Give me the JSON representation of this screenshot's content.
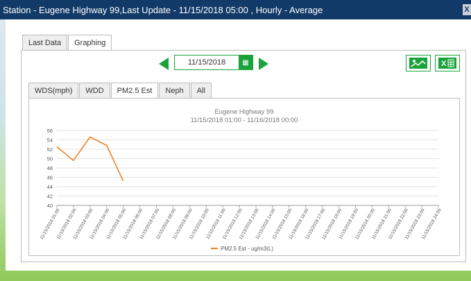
{
  "window": {
    "title": "Station - Eugene Highway 99,Last Update - 11/15/2018 05:00 , Hourly - Average",
    "close_label": "X"
  },
  "outer_tabs": [
    {
      "label": "Last Data",
      "active": false
    },
    {
      "label": "Graphing",
      "active": true
    }
  ],
  "date_picker": {
    "value": "11/15/2018",
    "calendar_icon": "calendar-icon"
  },
  "export": {
    "chart_icon": "chart-image-icon",
    "excel_icon": "excel-icon",
    "excel_label": "X"
  },
  "inner_tabs": [
    {
      "label": "WDS(mph)",
      "active": false
    },
    {
      "label": "WDD",
      "active": false
    },
    {
      "label": "PM2.5 Est",
      "active": true
    },
    {
      "label": "Neph",
      "active": false
    },
    {
      "label": "All",
      "active": false
    }
  ],
  "colors": {
    "accent": "#1aa33a",
    "series": "#f07f23",
    "title_bar": "#123a68"
  },
  "chart_data": {
    "type": "line",
    "title": "Eugene Highway 99",
    "subtitle": "11/15/2018 01:00  -  11/16/2018 00:00",
    "x": [
      "11/15/2018 01:00",
      "11/15/2018 02:00",
      "11/15/2018 03:00",
      "11/15/2018 04:00",
      "11/15/2018 05:00",
      "11/15/2018 06:00",
      "11/15/2018 07:00",
      "11/15/2018 08:00",
      "11/15/2018 09:00",
      "11/15/2018 10:00",
      "11/15/2018 11:00",
      "11/15/2018 12:00",
      "11/15/2018 13:00",
      "11/15/2018 14:00",
      "11/15/2018 15:00",
      "11/15/2018 16:00",
      "11/15/2018 17:00",
      "11/15/2018 18:00",
      "11/15/2018 19:00",
      "11/15/2018 20:00",
      "11/15/2018 21:00",
      "11/15/2018 22:00",
      "11/15/2018 23:00",
      "11/15/2018 24:00"
    ],
    "series": [
      {
        "name": "PM2.5 Est - ug/m3(L)",
        "values": [
          52.5,
          49.6,
          54.6,
          52.8,
          45.2
        ]
      }
    ],
    "ylim": [
      40,
      56
    ],
    "yticks": [
      40,
      42,
      44,
      46,
      48,
      50,
      52,
      54,
      56
    ],
    "grid": true,
    "legend": "bottom-center"
  }
}
